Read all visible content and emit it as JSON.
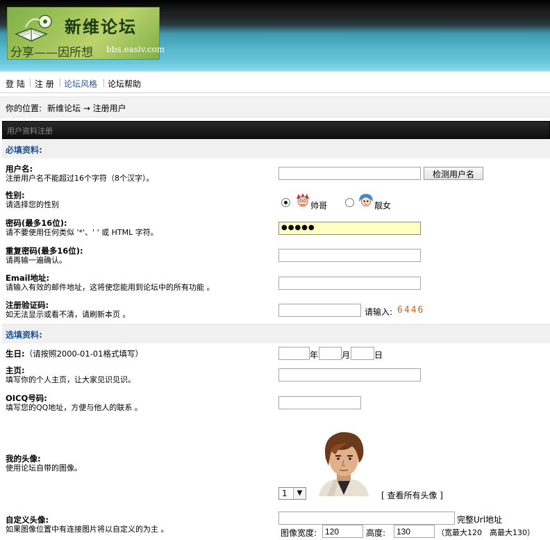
{
  "header": {
    "logo_title": "新维论坛",
    "logo_slogan": "分享——因所想",
    "logo_site": "bbs.easiv.com"
  },
  "nav": {
    "items": [
      "登 陆",
      "注 册",
      "论坛风格",
      "论坛帮助"
    ]
  },
  "breadcrumb": {
    "label": "你的位置:",
    "path": "新维论坛 → 注册用户"
  },
  "panel": {
    "title": "用户资料注册"
  },
  "required": {
    "heading": "必填资料:",
    "username": {
      "label": "用户名:",
      "desc": "注册用户名不能超过16个字符（8个汉字）。",
      "value": "",
      "check_button": "检测用户名"
    },
    "gender": {
      "label": "性别:",
      "desc": "请选择您的性别",
      "options": [
        "帅哥",
        "靓女"
      ],
      "selected": "帅哥"
    },
    "password": {
      "label": "密码(最多16位):",
      "desc": "请不要使用任何类似 '*'、' ' 或 HTML 字符。",
      "value": "●●●●●"
    },
    "password_confirm": {
      "label": "重复密码(最多16位):",
      "desc": "请再输一遍确认。",
      "value": ""
    },
    "email": {
      "label": "Email地址:",
      "desc": "请输入有效的邮件地址，这将使您能用到论坛中的所有功能 。",
      "value": ""
    },
    "captcha": {
      "label": "注册验证码:",
      "desc": "如无法显示或看不清，请刷新本页 。",
      "value": "",
      "prompt": "请输入:",
      "code": "6446"
    }
  },
  "optional": {
    "heading": "选填资料:",
    "birthday": {
      "label": "生日:",
      "note": "（请按照2000-01-01格式填写）",
      "year_unit": "年",
      "month_unit": "月",
      "day_unit": "日"
    },
    "homepage": {
      "label": "主页:",
      "desc": "填写你的个人主页，让大家见识见识。",
      "value": ""
    },
    "oicq": {
      "label": "OICQ号码:",
      "desc": "填写您的QQ地址，方便与他人的联系 。",
      "value": ""
    },
    "avatar": {
      "label": "我的头像:",
      "desc": "使用论坛自带的图像。",
      "selected": "1",
      "view_all": "[ 查看所有头像 ]"
    },
    "custom_avatar": {
      "label": "自定义头像:",
      "desc": "如果图像位置中有连接图片将以自定义的为主 。",
      "url_value": "",
      "url_hint": "完整Url地址",
      "width_label": "图像宽度:",
      "width_value": "120",
      "height_label": "高度:",
      "height_value": "130",
      "limits": "（宽最大120　高最大130）"
    }
  },
  "colors": {
    "link_blue": "#1f5ba8",
    "section_blue": "#1f5090",
    "captcha_orange": "#c0641a",
    "password_bg": "#ffffc4"
  }
}
